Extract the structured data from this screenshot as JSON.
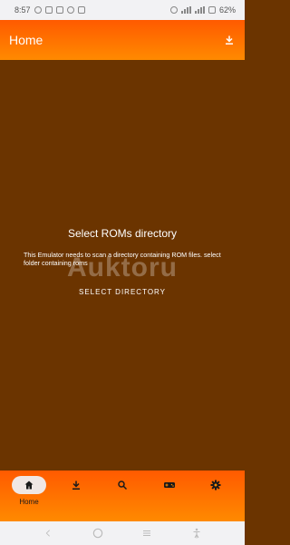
{
  "status_bar": {
    "time": "8:57",
    "battery": "62%"
  },
  "app_bar": {
    "title": "Home",
    "action_icon": "download-icon"
  },
  "main": {
    "title": "Select ROMs directory",
    "body": "This Emulator needs to scan a directory containing ROM files. select folder containing roms",
    "button_label": "SELECT DIRECTORY",
    "watermark": "Auktoru"
  },
  "bottom_nav": {
    "items": [
      {
        "icon": "home-icon",
        "label": "Home",
        "active": true
      },
      {
        "icon": "download-icon",
        "label": "",
        "active": false
      },
      {
        "icon": "search-icon",
        "label": "",
        "active": false
      },
      {
        "icon": "gamepad-icon",
        "label": "",
        "active": false
      },
      {
        "icon": "gear-icon",
        "label": "",
        "active": false
      }
    ]
  },
  "colors": {
    "accent": "#ff6f00",
    "background": "#6b3400",
    "text": "#ffffff"
  }
}
